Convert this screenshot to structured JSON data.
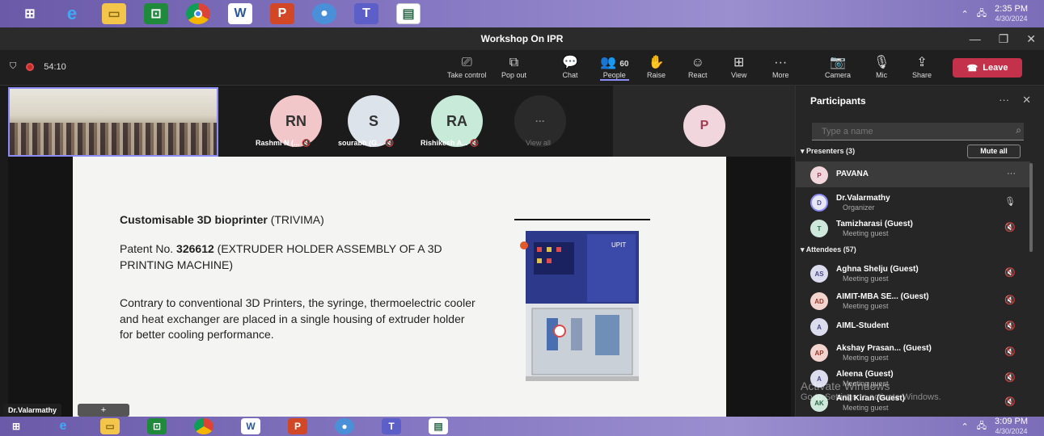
{
  "taskbar_top": {
    "icons": [
      "windows-start",
      "internet-explorer",
      "file-explorer",
      "store",
      "chrome",
      "word",
      "powerpoint",
      "paint",
      "teams",
      "app"
    ],
    "time": "2:35 PM",
    "date": "4/30/2024"
  },
  "taskbar_bottom": {
    "time": "3:09 PM",
    "date": "4/30/2024"
  },
  "window": {
    "title": "Workshop On IPR"
  },
  "toolbar": {
    "timer": "54:10",
    "take_control": "Take control",
    "pop_out": "Pop out",
    "chat": "Chat",
    "people": "People",
    "people_count": "60",
    "raise": "Raise",
    "react": "React",
    "view": "View",
    "more": "More",
    "camera": "Camera",
    "mic": "Mic",
    "share": "Share",
    "leave": "Leave"
  },
  "gallery": {
    "tiles": [
      {
        "initials": "RN",
        "name": "Rashmi N (...",
        "color": "#f2c7c9"
      },
      {
        "initials": "S",
        "name": "sourabh (G...",
        "color": "#dde3ea"
      },
      {
        "initials": "RA",
        "name": "Rishikesh A...",
        "color": "#c7ead9"
      }
    ],
    "view_all": "View all",
    "presenter_initial": "P"
  },
  "slide": {
    "title_bold": "Customisable 3D bioprinter",
    "title_rest": " (TRIVIMA)",
    "patent_prefix": "Patent No. ",
    "patent_no": "326612",
    "patent_rest": " (EXTRUDER HOLDER ASSEMBLY OF A 3D PRINTING MACHINE)",
    "description": "Contrary to conventional 3D Printers, the syringe, thermoelectric cooler and heat exchanger are placed in a single housing of extruder holder for better cooling performance.",
    "machine_label": "UPIT"
  },
  "stage": {
    "speaker_tag": "Dr.Valarmathy",
    "plus": "+"
  },
  "panel": {
    "title": "Participants",
    "search_placeholder": "Type a name",
    "presenters_label": "Presenters (3)",
    "mute_all": "Mute all",
    "attendees_label": "Attendees (57)",
    "presenters": [
      {
        "initials": "P",
        "name": "PAVANA",
        "sub": "",
        "bg": "#f1d7dd",
        "fg": "#a33b53",
        "right": "···"
      },
      {
        "initials": "D",
        "name": "Dr.Valarmathy",
        "sub": "Organizer",
        "bg": "#e8e8f5",
        "fg": "#4a4a9a",
        "right": "🎙"
      },
      {
        "initials": "T",
        "name": "Tamizharasi (Guest)",
        "sub": "Meeting guest",
        "bg": "#cfe8dc",
        "fg": "#2d6a4a",
        "right": "🔇"
      }
    ],
    "attendees": [
      {
        "initials": "AS",
        "name": "Aghna Shelju (Guest)",
        "sub": "Meeting guest",
        "bg": "#dcdcef",
        "fg": "#4a4a8a",
        "right": "🔇"
      },
      {
        "initials": "AD",
        "name": "AIMIT-MBA SE...  (Guest)",
        "sub": "Meeting guest",
        "bg": "#f4d4cf",
        "fg": "#9a3b2b",
        "right": "🔇"
      },
      {
        "initials": "A",
        "name": "AIML-Student",
        "sub": "",
        "bg": "#dcdcef",
        "fg": "#4a4a8a",
        "right": "🔇"
      },
      {
        "initials": "AP",
        "name": "Akshay Prasan...  (Guest)",
        "sub": "Meeting guest",
        "bg": "#f4d4cf",
        "fg": "#9a3b2b",
        "right": "🔇"
      },
      {
        "initials": "A",
        "name": "Aleena (Guest)",
        "sub": "Meeting guest",
        "bg": "#dcdcef",
        "fg": "#4a4a8a",
        "right": "🔇"
      },
      {
        "initials": "AK",
        "name": "Anil Kiran (Guest)",
        "sub": "Meeting guest",
        "bg": "#cfe8dc",
        "fg": "#2d6a4a",
        "right": "🔇"
      }
    ]
  },
  "watermark": {
    "line1": "Activate Windows",
    "line2": "Go to Settings to activate Windows."
  }
}
